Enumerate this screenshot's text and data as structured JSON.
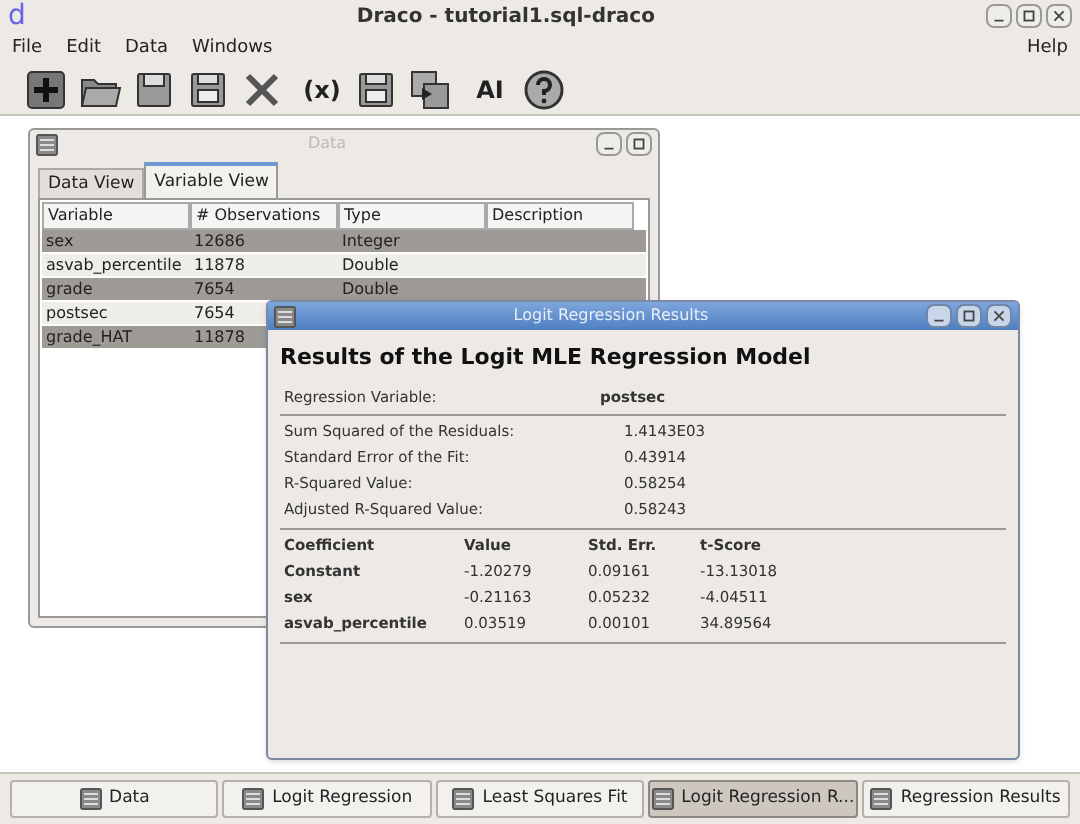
{
  "window": {
    "title": "Draco - tutorial1.sql-draco",
    "logo": "d"
  },
  "menu": {
    "left": [
      "File",
      "Edit",
      "Data",
      "Windows"
    ],
    "right": [
      "Help"
    ]
  },
  "toolbar": [
    {
      "kind": "new"
    },
    {
      "kind": "open"
    },
    {
      "kind": "save"
    },
    {
      "kind": "saveas"
    },
    {
      "kind": "close"
    },
    {
      "kind": "text",
      "label": "(x)"
    },
    {
      "kind": "saveas"
    },
    {
      "kind": "copy"
    },
    {
      "kind": "text",
      "label": "AI"
    },
    {
      "kind": "help"
    }
  ],
  "data_window": {
    "title": "Data",
    "tabs": [
      {
        "label": "Data View",
        "selected": false
      },
      {
        "label": "Variable View",
        "selected": true
      }
    ],
    "columns": [
      "Variable",
      "# Observations",
      "Type",
      "Description"
    ],
    "rows": [
      {
        "cells": [
          "sex",
          "12686",
          "Integer"
        ],
        "selected": true
      },
      {
        "cells": [
          "asvab_percentile",
          "11878",
          "Double"
        ],
        "selected": false
      },
      {
        "cells": [
          "grade",
          "7654",
          "Double"
        ],
        "selected": true
      },
      {
        "cells": [
          "postsec",
          "7654"
        ],
        "selected": false
      },
      {
        "cells": [
          "grade_HAT",
          "11878"
        ],
        "selected": true
      }
    ]
  },
  "results_window": {
    "title": "Logit Regression Results",
    "heading": "Results of the Logit MLE Regression Model",
    "regression_variable": {
      "label": "Regression Variable:",
      "value": "postsec"
    },
    "stats": [
      {
        "label": "Sum Squared of the Residuals:",
        "value": "1.4143E03"
      },
      {
        "label": "Standard Error of the Fit:",
        "value": "0.43914"
      },
      {
        "label": "R-Squared Value:",
        "value": "0.58254"
      },
      {
        "label": "Adjusted R-Squared Value:",
        "value": "0.58243"
      }
    ],
    "columns": [
      "Coefficient",
      "Value",
      "Std. Err.",
      "t-Score"
    ],
    "rows": [
      [
        "Constant",
        "-1.20279",
        "0.09161",
        "-13.13018"
      ],
      [
        "sex",
        "-0.21163",
        "0.05232",
        "-4.04511"
      ],
      [
        "asvab_percentile",
        "0.03519",
        "0.00101",
        "34.89564"
      ]
    ]
  },
  "taskbar": [
    {
      "label": "Data",
      "selected": false
    },
    {
      "label": "Logit Regression",
      "selected": false
    },
    {
      "label": "Least Squares Fit",
      "selected": false
    },
    {
      "label": "Logit Regression R...",
      "selected": true
    },
    {
      "label": "Regression Results",
      "selected": false
    }
  ]
}
